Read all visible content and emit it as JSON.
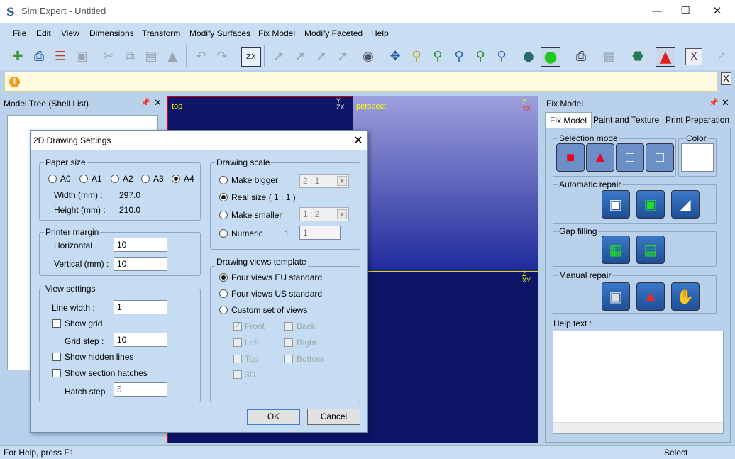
{
  "app": {
    "title": "Sim Expert - Untitled"
  },
  "menu": [
    "File",
    "Edit",
    "View",
    "Dimensions",
    "Transform",
    "Modify Surfaces",
    "Fix Model",
    "Modify Faceted",
    "Help"
  ],
  "model_tree": {
    "title": "Model Tree (Shell List)"
  },
  "viewports": {
    "top": "top",
    "perspective": "perspect",
    "left_partial": "t"
  },
  "fix_model": {
    "title": "Fix Model",
    "tabs": [
      "Fix Model",
      "Paint and Texture",
      "Print Preparation"
    ],
    "selection_mode": "Selection mode",
    "color": "Color",
    "automatic_repair": "Automatic repair",
    "gap_filling": "Gap filling",
    "manual_repair": "Manual repair",
    "help_text": "Help text :"
  },
  "status": {
    "left": "For Help, press F1",
    "right": "Select"
  },
  "dialog": {
    "title": "2D Drawing Settings",
    "paper_size": {
      "label": "Paper size",
      "options": [
        "A0",
        "A1",
        "A2",
        "A3",
        "A4"
      ],
      "selected": "A4",
      "width_label": "Width (mm) :",
      "width_value": "297.0",
      "height_label": "Height (mm) :",
      "height_value": "210.0"
    },
    "printer_margin": {
      "label": "Printer margin",
      "horizontal_label": "Horizontal",
      "horizontal_value": "10",
      "vertical_label": "Vertical (mm) :",
      "vertical_value": "10"
    },
    "view_settings": {
      "label": "View settings",
      "line_width_label": "Line width :",
      "line_width_value": "1",
      "show_grid": "Show grid",
      "grid_step_label": "Grid step :",
      "grid_step_value": "10",
      "show_hidden": "Show hidden lines",
      "show_section": "Show section hatches",
      "hatch_step_label": "Hatch step",
      "hatch_step_value": "5"
    },
    "drawing_scale": {
      "label": "Drawing scale",
      "make_bigger": "Make bigger",
      "bigger_value": "2 : 1",
      "real_size": "Real size ( 1 : 1 )",
      "make_smaller": "Make smaller",
      "smaller_value": "1 : 2",
      "numeric": "Numeric",
      "numeric_prefix": "1",
      "numeric_value": "1"
    },
    "views_template": {
      "label": "Drawing views template",
      "eu": "Four views EU standard",
      "us": "Four views US standard",
      "custom": "Custom set of views",
      "front": "Front",
      "back": "Back",
      "left": "Left",
      "right": "Right",
      "top": "Top",
      "bottom": "Bottom",
      "threed": "3D"
    },
    "ok": "OK",
    "cancel": "Cancel"
  }
}
